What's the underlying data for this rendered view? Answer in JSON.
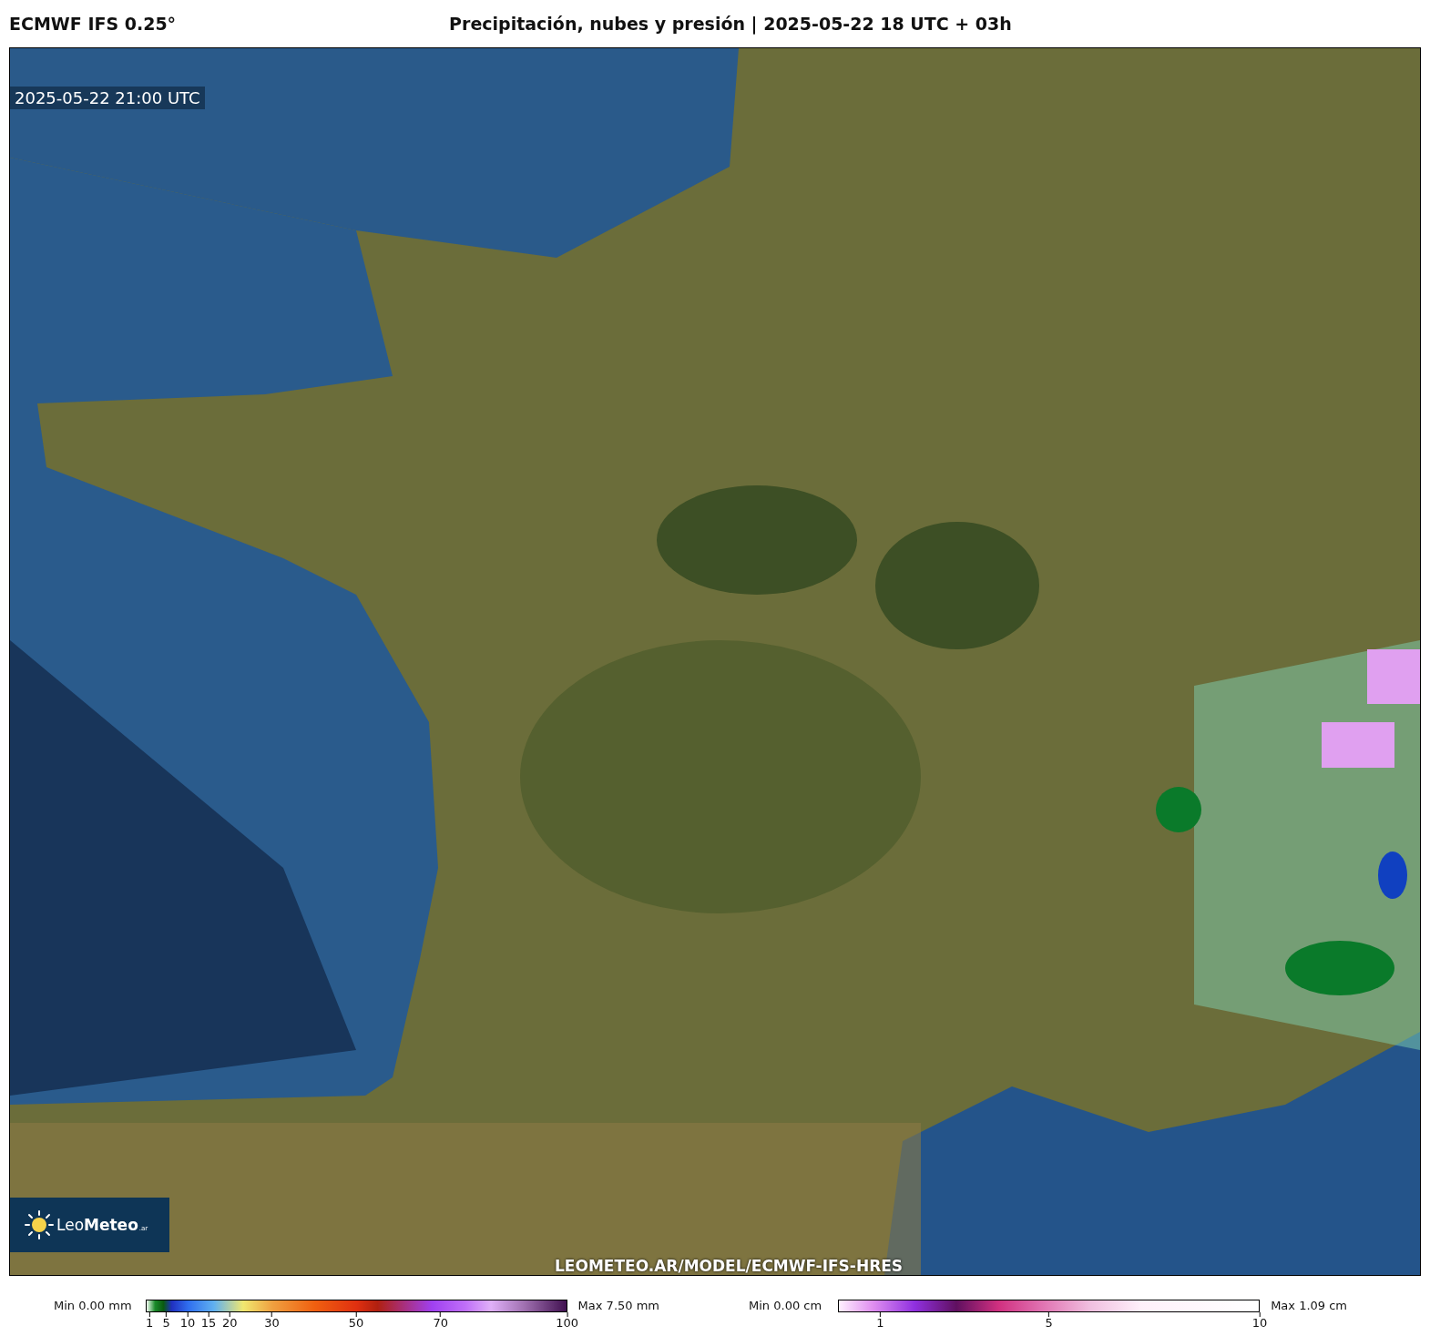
{
  "header": {
    "model": "ECMWF IFS 0.25°",
    "title": "Precipitación, nubes y presión | 2025-05-22 18 UTC + 03h"
  },
  "map": {
    "timestamp": "2025-05-22 21:00 UTC",
    "logo": {
      "name": "Leo**Meteo**",
      "suffix": ".ar"
    },
    "credit": "LEOMETEO.AR/MODEL/ECMWF-IFS-HRES"
  },
  "legends": [
    {
      "kind": "rain",
      "min": "Min 0.00 mm",
      "max": "Max 7.50 mm",
      "ticks": [
        "1",
        "5",
        "10",
        "15",
        "20",
        "30",
        "50",
        "70",
        "100"
      ]
    },
    {
      "kind": "snow",
      "min": "Min 0.00 cm",
      "max": "Max 1.09 cm",
      "ticks": [
        "1",
        "5",
        "10"
      ]
    }
  ]
}
